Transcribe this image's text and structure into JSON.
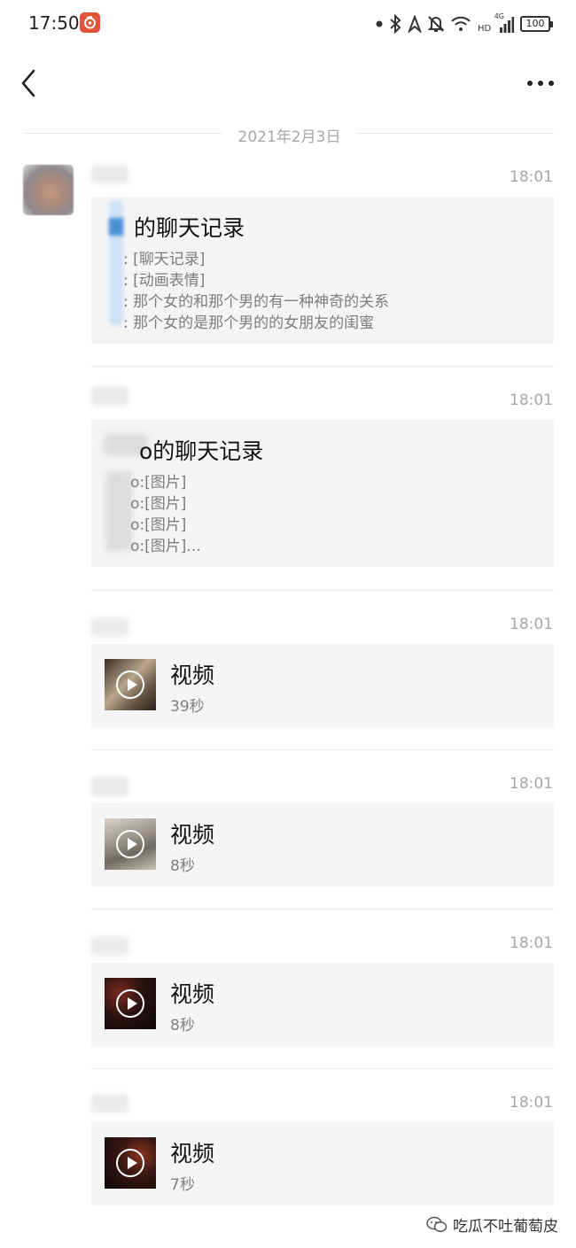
{
  "status_bar": {
    "time": "17:50",
    "network_hd": "HD",
    "network_gen": "4G",
    "battery": "100"
  },
  "chat": {
    "date": "2021年2月3日"
  },
  "messages": [
    {
      "time": "18:01",
      "kind": "chat_record",
      "title": "的聊天记录",
      "lines": [
        ": [聊天记录]",
        ": [动画表情]",
        ": 那个女的和那个男的有一种神奇的关系",
        ": 那个女的是那个男的的女朋友的闺蜜"
      ]
    },
    {
      "time": "18:01",
      "kind": "chat_record",
      "title": "o的聊天记录",
      "lines": [
        "o:[图片]",
        "o:[图片]",
        "o:[图片]",
        "o:[图片]..."
      ]
    },
    {
      "time": "18:01",
      "kind": "video",
      "label": "视频",
      "duration": "39秒"
    },
    {
      "time": "18:01",
      "kind": "video",
      "label": "视频",
      "duration": "8秒"
    },
    {
      "time": "18:01",
      "kind": "video",
      "label": "视频",
      "duration": "8秒"
    },
    {
      "time": "18:01",
      "kind": "video",
      "label": "视频",
      "duration": "7秒"
    }
  ],
  "watermark": {
    "text": "吃瓜不吐葡萄皮"
  },
  "colors": {
    "app_badge": "#e0533b",
    "card_background": "#f5f5f5",
    "muted_text": "#a6a6a6"
  },
  "icons": [
    "app-notification-icon",
    "dot-icon",
    "bluetooth-icon",
    "location-icon",
    "bell-off-icon",
    "wifi-icon",
    "signal-icon",
    "battery-icon",
    "back-arrow-icon",
    "more-dots-icon",
    "play-icon",
    "wechat-watermark-icon"
  ]
}
